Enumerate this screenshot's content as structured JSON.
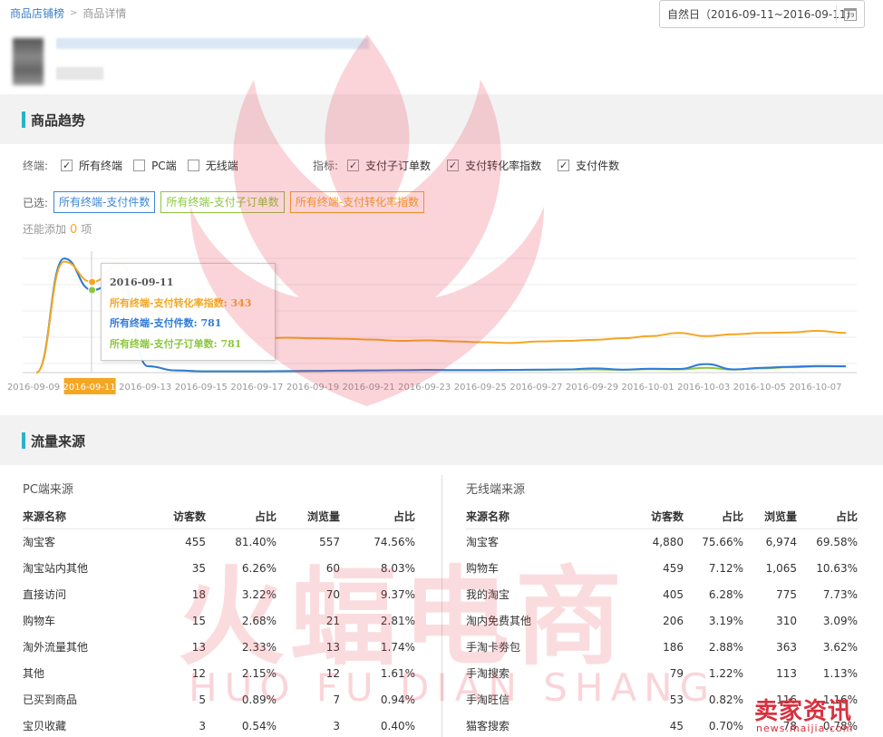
{
  "breadcrumb": {
    "parent": "商品店铺榜",
    "current": "商品详情"
  },
  "date_picker": {
    "label": "自然日（2016-09-11~2016-09-11）",
    "icon": "calendar-icon"
  },
  "trend": {
    "title": "商品趋势",
    "terminal_label": "终端:",
    "terminals": [
      {
        "label": "所有终端",
        "checked": true
      },
      {
        "label": "PC端",
        "checked": false
      },
      {
        "label": "无线端",
        "checked": false
      }
    ],
    "metric_label": "指标:",
    "metrics": [
      {
        "label": "支付子订单数",
        "checked": true
      },
      {
        "label": "支付转化率指数",
        "checked": true
      },
      {
        "label": "支付件数",
        "checked": true
      }
    ],
    "selected_label": "已选:",
    "selected_tags": [
      "所有终端-支付件数",
      "所有终端-支付子订单数",
      "所有终端-支付转化率指数"
    ],
    "add_prefix": "还能添加",
    "add_count": "0",
    "add_suffix": "项",
    "tooltip": {
      "date": "2016-09-11",
      "line1": "所有终端-支付转化率指数: 343",
      "line2": "所有终端-支付件数: 781",
      "line3": "所有终端-支付子订单数: 781"
    }
  },
  "chart_data": {
    "type": "line",
    "x_tick_labels": [
      "2016-09-09",
      "2016-09-11",
      "2016-09-13",
      "2016-09-15",
      "2016-09-17",
      "2016-09-19",
      "2016-09-21",
      "2016-09-23",
      "2016-09-25",
      "2016-09-27",
      "2016-09-29",
      "2016-10-01",
      "2016-10-03",
      "2016-10-05",
      "2016-10-07"
    ],
    "highlighted_tick": "2016-09-11",
    "x": [
      "09-09",
      "09-10",
      "09-11",
      "09-12",
      "09-13",
      "09-14",
      "09-15",
      "09-16",
      "09-17",
      "09-18",
      "09-19",
      "09-20",
      "09-21",
      "09-22",
      "09-23",
      "09-24",
      "09-25",
      "09-26",
      "09-27",
      "09-28",
      "09-29",
      "09-30",
      "10-01",
      "10-02",
      "10-03",
      "10-04",
      "10-05",
      "10-06",
      "10-07",
      "10-08"
    ],
    "series": [
      {
        "name": "所有终端-支付转化率指数",
        "color": "#f5a623",
        "values": [
          0,
          420,
          343,
          410,
          230,
          150,
          140,
          135,
          130,
          132,
          130,
          128,
          125,
          120,
          122,
          118,
          115,
          112,
          118,
          120,
          124,
          130,
          138,
          150,
          138,
          145,
          150,
          152,
          158,
          150
        ]
      },
      {
        "name": "所有终端-支付件数",
        "color": "#2f7bd9",
        "values": [
          0,
          1080,
          781,
          900,
          60,
          20,
          12,
          12,
          12,
          14,
          16,
          18,
          20,
          22,
          26,
          24,
          24,
          26,
          28,
          30,
          40,
          28,
          36,
          34,
          80,
          30,
          45,
          55,
          62,
          60
        ]
      },
      {
        "name": "所有终端-支付子订单数",
        "color": "#8cc63f",
        "values": [
          0,
          1080,
          781,
          900,
          60,
          20,
          12,
          12,
          12,
          14,
          16,
          18,
          20,
          22,
          24,
          22,
          22,
          24,
          26,
          28,
          30,
          26,
          32,
          30,
          45,
          28,
          40,
          50,
          58,
          58
        ]
      }
    ],
    "grid": true,
    "legend": "none"
  },
  "traffic": {
    "title": "流量来源",
    "pc": {
      "title": "PC端来源",
      "headers": [
        "来源名称",
        "访客数",
        "占比",
        "浏览量",
        "占比"
      ],
      "rows": [
        [
          "淘宝客",
          "455",
          "81.40%",
          "557",
          "74.56%"
        ],
        [
          "淘宝站内其他",
          "35",
          "6.26%",
          "60",
          "8.03%"
        ],
        [
          "直接访问",
          "18",
          "3.22%",
          "70",
          "9.37%"
        ],
        [
          "购物车",
          "15",
          "2.68%",
          "21",
          "2.81%"
        ],
        [
          "淘外流量其他",
          "13",
          "2.33%",
          "13",
          "1.74%"
        ],
        [
          "其他",
          "12",
          "2.15%",
          "12",
          "1.61%"
        ],
        [
          "已买到商品",
          "5",
          "0.89%",
          "7",
          "0.94%"
        ],
        [
          "宝贝收藏",
          "3",
          "0.54%",
          "3",
          "0.40%"
        ]
      ]
    },
    "wireless": {
      "title": "无线端来源",
      "headers": [
        "来源名称",
        "访客数",
        "占比",
        "浏览量",
        "占比"
      ],
      "rows": [
        [
          "淘宝客",
          "4,880",
          "75.66%",
          "6,974",
          "69.58%"
        ],
        [
          "购物车",
          "459",
          "7.12%",
          "1,065",
          "10.63%"
        ],
        [
          "我的淘宝",
          "405",
          "6.28%",
          "775",
          "7.73%"
        ],
        [
          "淘内免费其他",
          "206",
          "3.19%",
          "310",
          "3.09%"
        ],
        [
          "手淘卡劵包",
          "186",
          "2.88%",
          "363",
          "3.62%"
        ],
        [
          "手淘搜索",
          "79",
          "1.22%",
          "113",
          "1.13%"
        ],
        [
          "手淘旺信",
          "53",
          "0.82%",
          "116",
          "1.16%"
        ],
        [
          "猫客搜索",
          "45",
          "0.70%",
          "78",
          "0.78%"
        ]
      ]
    }
  },
  "watermark": {
    "main": "火蝠电商",
    "sub": "HUO FU DIAN SHANG",
    "corner_big": "卖家资讯",
    "corner_small": "news.maijia.com"
  }
}
